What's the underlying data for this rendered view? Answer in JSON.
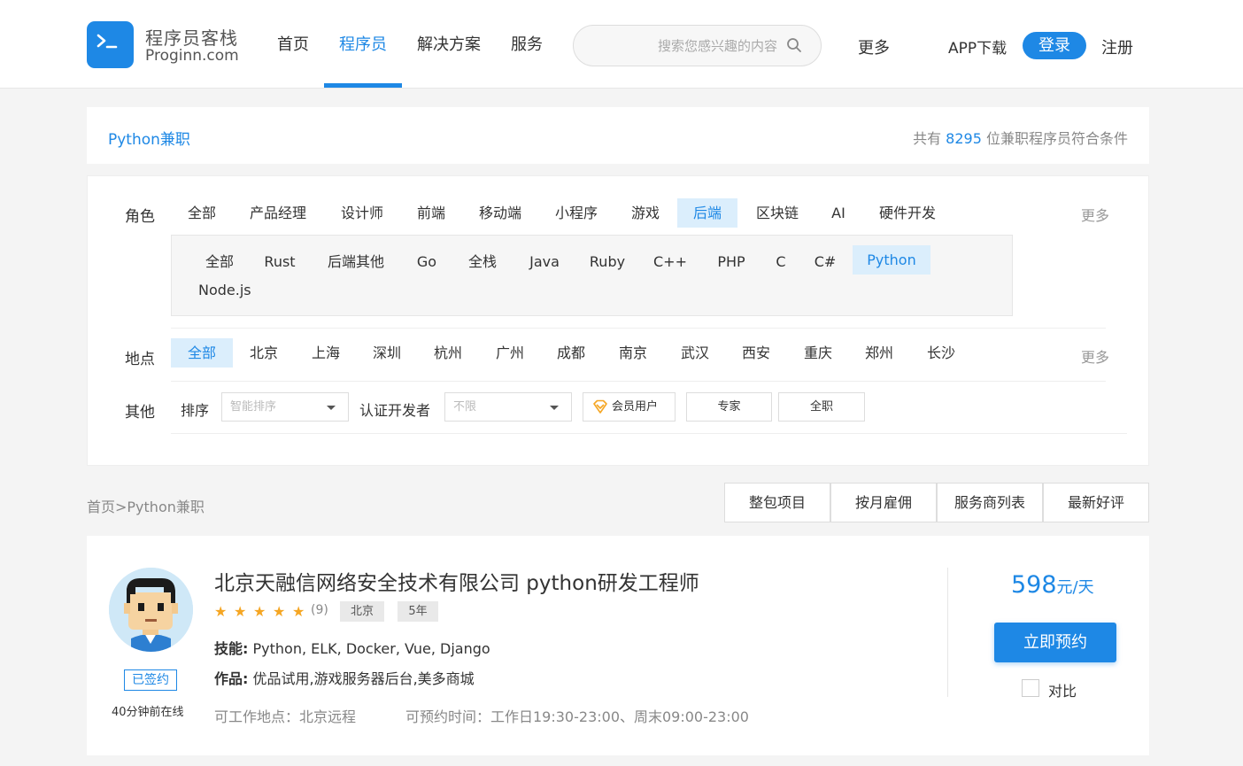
{
  "header": {
    "logo_cn": "程序员客栈",
    "logo_en": "Proginn.com",
    "nav": [
      "首页",
      "程序员",
      "解决方案",
      "服务"
    ],
    "search_placeholder": "搜索您感兴趣的内容",
    "more": "更多",
    "app_download": "APP下载",
    "login": "登录",
    "register": "注册"
  },
  "title_bar": {
    "title": "Python兼职",
    "count_prefix": "共有",
    "count": "8295",
    "count_suffix": "位兼职程序员符合条件"
  },
  "filters": {
    "role_label": "角色",
    "roles": [
      "全部",
      "产品经理",
      "设计师",
      "前端",
      "移动端",
      "小程序",
      "游戏",
      "后端",
      "区块链",
      "AI",
      "硬件开发"
    ],
    "role_more": "更多",
    "subroles": [
      "全部",
      "Rust",
      "后端其他",
      "Go",
      "全栈",
      "Java",
      "Ruby",
      "C++",
      "PHP",
      "C",
      "C#",
      "Python",
      "Node.js"
    ],
    "location_label": "地点",
    "locations": [
      "全部",
      "北京",
      "上海",
      "深圳",
      "杭州",
      "广州",
      "成都",
      "南京",
      "武汉",
      "西安",
      "重庆",
      "郑州",
      "长沙"
    ],
    "location_more": "更多",
    "other_label": "其他",
    "sort_label": "排序",
    "sort_value": "智能排序",
    "cert_label": "认证开发者",
    "cert_value": "不限",
    "member_btn": "会员用户",
    "expert_btn": "专家",
    "fulltime_btn": "全职"
  },
  "breadcrumb": "首页>Python兼职",
  "tabs": [
    "整包项目",
    "按月雇佣",
    "服务商列表",
    "最新好评"
  ],
  "card": {
    "signed": "已签约",
    "online": "40分钟前在线",
    "title": "北京天融信网络安全技术有限公司 python研发工程师",
    "rating": 5,
    "review_count": "(9)",
    "city": "北京",
    "years": "5年",
    "skills_label": "技能:",
    "skills": "Python, ELK, Docker, Vue, Django",
    "works_label": "作品:",
    "works": "优品试用,游戏服务器后台,美多商城",
    "workplace": "可工作地点：北京远程",
    "available": "可预约时间：工作日19:30-23:00、周末09:00-23:00",
    "price": "598",
    "price_unit": "元/天",
    "book": "立即预约",
    "compare": "对比",
    "colors": {
      "accent": "#1e88e5",
      "star": "#f5a623"
    }
  }
}
